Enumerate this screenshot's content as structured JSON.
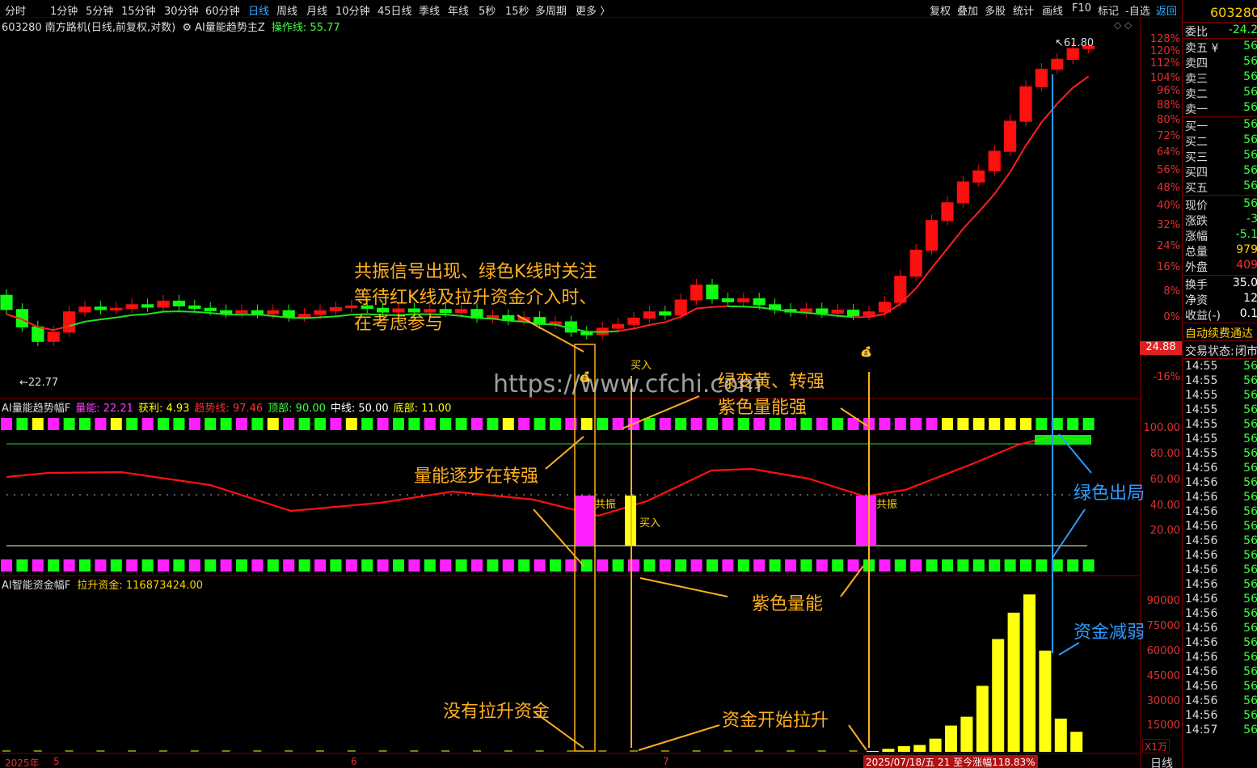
{
  "toolbar": {
    "items": [
      "分时",
      "1分钟",
      "5分钟",
      "15分钟",
      "30分钟",
      "60分钟",
      "日线",
      "周线",
      "月线",
      "10分钟",
      "45日线",
      "季线",
      "年线",
      "5秒",
      "15秒",
      "多周期",
      "更多 〉"
    ],
    "active": "日线",
    "right_items": [
      "复权",
      "叠加",
      "多股",
      "统计",
      "画线",
      "F10",
      "标记",
      "-自选",
      "返回"
    ]
  },
  "main_panel": {
    "stock_title": "603280 南方路机(日线,前复权,对数)",
    "indicator_name": "AI量能趋势主Z",
    "op_line_label": "操作线:",
    "op_line_value": "55.77",
    "high_label": "61.80",
    "low_label": "22.77",
    "current_price_tag": "24.88",
    "y_ticks": [
      "128%",
      "120%",
      "112%",
      "104%",
      "96%",
      "88%",
      "80%",
      "72%",
      "64%",
      "56%",
      "48%",
      "40%",
      "32%",
      "24%",
      "16%",
      "8%",
      "0%",
      "-16%"
    ],
    "buy_marker": "买入"
  },
  "sub1": {
    "name": "AI量能趋势幅F",
    "items": [
      {
        "label": "量能:",
        "value": "22.21",
        "color": "#ff40ff"
      },
      {
        "label": "获利:",
        "value": "4.93",
        "color": "#ffff00"
      },
      {
        "label": "趋势线:",
        "value": "97.46",
        "color": "#ff3030"
      },
      {
        "label": "顶部:",
        "value": "90.00",
        "color": "#40ff40"
      },
      {
        "label": "中线:",
        "value": "50.00",
        "color": "#ffffff"
      },
      {
        "label": "底部:",
        "value": "11.00",
        "color": "#ffff00"
      }
    ],
    "y_ticks": [
      "100.00",
      "80.00",
      "60.00",
      "40.00",
      "20.00"
    ],
    "resonance": "共振",
    "buy": "买入"
  },
  "sub2": {
    "name": "AI智能资金幅F",
    "label": "拉升资金:",
    "value": "116873424.00",
    "y_ticks": [
      "90000",
      "75000",
      "60000",
      "45000",
      "30000",
      "15000"
    ],
    "unit": "X1万",
    "bar_values_wan": [
      500,
      1800,
      3400,
      4100,
      7900,
      15700,
      21000,
      39500,
      67500,
      83300,
      94200,
      60600,
      19900,
      12000
    ]
  },
  "x_axis": {
    "labels": [
      "2025年",
      "5",
      "6",
      "7"
    ],
    "date_readout": "2025/07/18/五 21 至今涨幅118.83%"
  },
  "annotations": {
    "top_note": [
      "共振信号出现、绿色K线时关注",
      "等待红K线及拉升资金介入时、",
      "在考虑参与"
    ],
    "green_to_yellow": "绿变黄、转强",
    "purple_strong": "紫色量能强",
    "volume_improving": "量能逐步在转强",
    "green_exit": "绿色出局",
    "purple_volume": "紫色量能",
    "funds_weaken": "资金减弱",
    "no_funds": "没有拉升资金",
    "funds_start": "资金开始拉升",
    "watermark": "https://www.cfchi.com"
  },
  "right_panel": {
    "code": "603280",
    "weibi_label": "委比",
    "weibi_value": "-24.2",
    "sells": [
      {
        "label": "卖五 ¥",
        "value": "56"
      },
      {
        "label": "卖四",
        "value": "56"
      },
      {
        "label": "卖三",
        "value": "56"
      },
      {
        "label": "卖二",
        "value": "56"
      },
      {
        "label": "卖一",
        "value": "56"
      }
    ],
    "buys": [
      {
        "label": "买一",
        "value": "56"
      },
      {
        "label": "买二",
        "value": "56"
      },
      {
        "label": "买三",
        "value": "56"
      },
      {
        "label": "买四",
        "value": "56"
      },
      {
        "label": "买五",
        "value": "56"
      }
    ],
    "quote": [
      {
        "label": "现价",
        "value": "56",
        "color": "#40ff40"
      },
      {
        "label": "涨跌",
        "value": "-3",
        "color": "#40ff40"
      },
      {
        "label": "涨幅",
        "value": "-5.1",
        "color": "#40ff40"
      },
      {
        "label": "总量",
        "value": "979",
        "color": "#ffd000"
      },
      {
        "label": "外盘",
        "value": "409",
        "color": "#ff3030"
      }
    ],
    "stats": [
      {
        "label": "换手",
        "value": "35.0",
        "color": "#ffffff"
      },
      {
        "label": "净资",
        "value": "12",
        "color": "#ffffff"
      },
      {
        "label": "收益(-)",
        "value": "0.1",
        "color": "#ffffff"
      }
    ],
    "auto_renew": "自动续费通达",
    "trade_state_label": "交易状态:",
    "trade_state_value": "闭市",
    "ticks": [
      {
        "time": "14:55",
        "value": "56"
      },
      {
        "time": "14:55",
        "value": "56"
      },
      {
        "time": "14:55",
        "value": "56"
      },
      {
        "time": "14:55",
        "value": "56"
      },
      {
        "time": "14:55",
        "value": "56"
      },
      {
        "time": "14:55",
        "value": "56"
      },
      {
        "time": "14:55",
        "value": "56"
      },
      {
        "time": "14:56",
        "value": "56"
      },
      {
        "time": "14:56",
        "value": "56"
      },
      {
        "time": "14:56",
        "value": "56"
      },
      {
        "time": "14:56",
        "value": "56"
      },
      {
        "time": "14:56",
        "value": "56"
      },
      {
        "time": "14:56",
        "value": "56"
      },
      {
        "time": "14:56",
        "value": "56"
      },
      {
        "time": "14:56",
        "value": "56"
      },
      {
        "time": "14:56",
        "value": "56"
      },
      {
        "time": "14:56",
        "value": "56"
      },
      {
        "time": "14:56",
        "value": "56"
      },
      {
        "time": "14:56",
        "value": "56"
      },
      {
        "time": "14:56",
        "value": "56"
      },
      {
        "time": "14:56",
        "value": "56"
      },
      {
        "time": "14:56",
        "value": "56"
      },
      {
        "time": "14:56",
        "value": "56"
      },
      {
        "time": "14:56",
        "value": "56"
      },
      {
        "time": "14:56",
        "value": "56"
      },
      {
        "time": "14:57",
        "value": "56"
      }
    ],
    "bottom_tab": "日线"
  }
}
